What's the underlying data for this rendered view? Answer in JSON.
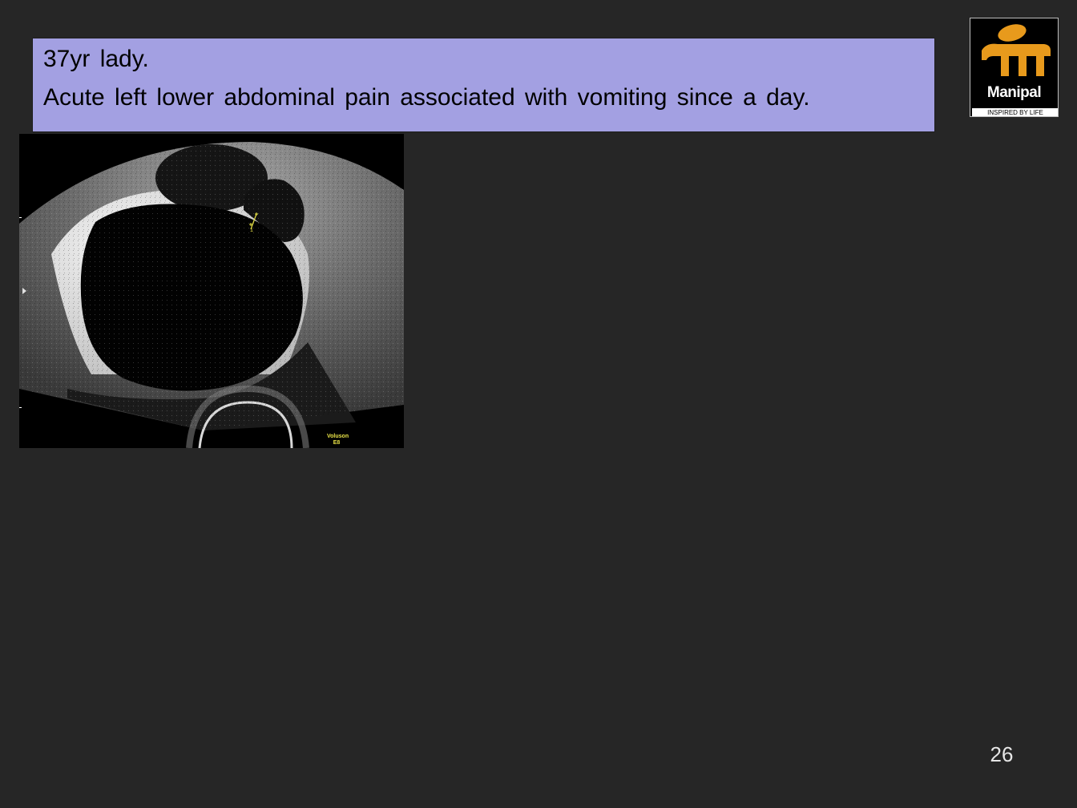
{
  "case": {
    "line1": "37yr lady.",
    "line2": "Acute left lower abdominal pain associated with vomiting since a day."
  },
  "logo": {
    "icon": "manipal-logo-icon",
    "word": "Manipal",
    "tagline": "INSPIRED BY LIFE",
    "color": "#e89a1c"
  },
  "scan": {
    "brand_line1": "Voluson",
    "brand_line2": "E8",
    "caliper_label": "1"
  },
  "slide": {
    "page_number": "26",
    "background": "#262626",
    "box_color": "#a3a0e2"
  }
}
